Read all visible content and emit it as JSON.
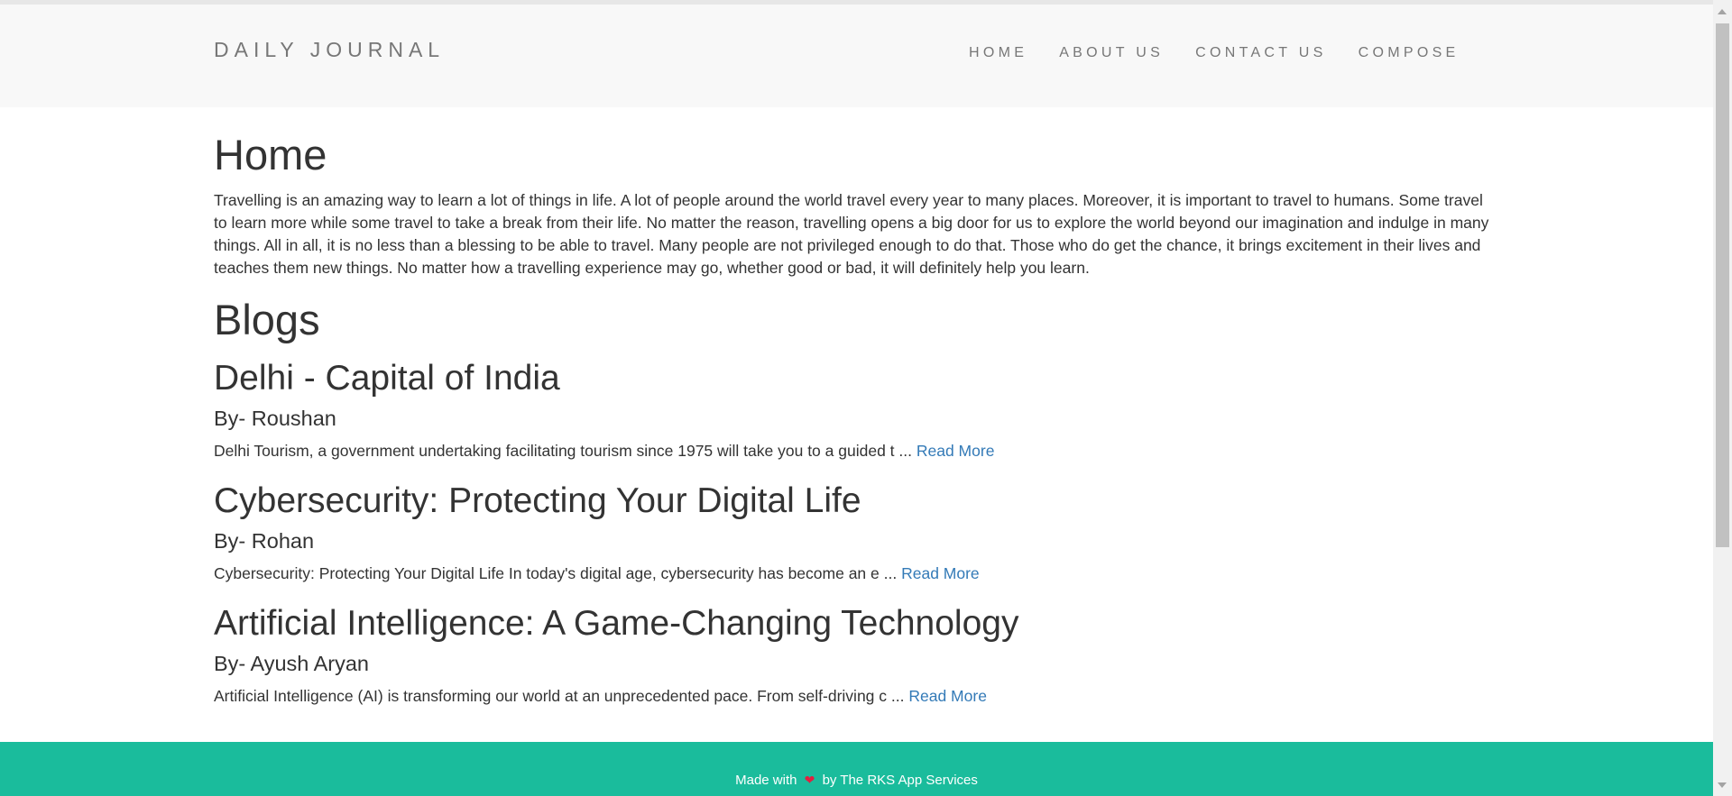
{
  "header": {
    "brand": "DAILY JOURNAL",
    "nav": [
      "HOME",
      "ABOUT US",
      "CONTACT US",
      "COMPOSE"
    ]
  },
  "home": {
    "title": "Home",
    "intro": "Travelling is an amazing way to learn a lot of things in life. A lot of people around the world travel every year to many places. Moreover, it is important to travel to humans. Some travel to learn more while some travel to take a break from their life. No matter the reason, travelling opens a big door for us to explore the world beyond our imagination and indulge in many things. All in all, it is no less than a blessing to be able to travel. Many people are not privileged enough to do that. Those who do get the chance, it brings excitement in their lives and teaches them new things. No matter how a travelling experience may go, whether good or bad, it will definitely help you learn."
  },
  "blogs": {
    "title": "Blogs",
    "read_more_label": "Read More",
    "posts": [
      {
        "title": "Delhi - Capital of India",
        "author": "By- Roushan",
        "excerpt": "Delhi Tourism, a government undertaking facilitating tourism since 1975 will take you to a guided t ..."
      },
      {
        "title": "Cybersecurity: Protecting Your Digital Life",
        "author": "By- Rohan",
        "excerpt": "Cybersecurity: Protecting Your Digital Life In today's digital age, cybersecurity has become an e ..."
      },
      {
        "title": "Artificial Intelligence: A Game-Changing Technology",
        "author": "By- Ayush Aryan",
        "excerpt": "Artificial Intelligence (AI) is transforming our world at an unprecedented pace. From self-driving c ..."
      }
    ]
  },
  "footer": {
    "prefix": "Made with",
    "icon": "heart-icon",
    "suffix": "by The RKS App Services"
  },
  "colors": {
    "navbar_bg": "#f8f8f8",
    "footer_bg": "#1abc9c",
    "link": "#337ab7",
    "heart": "#e02040"
  }
}
